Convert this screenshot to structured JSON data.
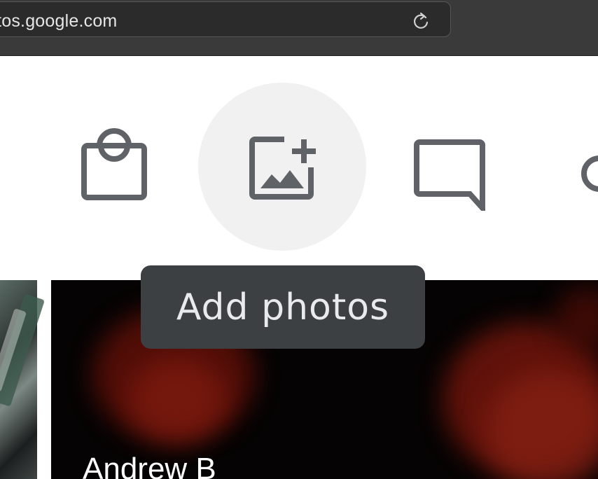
{
  "browser": {
    "url": "otos.google.com",
    "reload_icon": "reload-icon"
  },
  "toolbar": {
    "items": [
      {
        "name": "shopping-bag-icon",
        "label": ""
      },
      {
        "name": "add-photo-icon",
        "label": "Add photos"
      },
      {
        "name": "comment-icon",
        "label": ""
      },
      {
        "name": "partial-circle-icon",
        "label": ""
      }
    ]
  },
  "tooltip": {
    "text": "Add photos"
  },
  "photos": {
    "caption": "Andrew B"
  },
  "colors": {
    "icon": "#5f6368",
    "tooltip_bg": "#3c4043",
    "hover_circle": "#f1f1f1",
    "chrome_bg": "#3a3a3a"
  }
}
